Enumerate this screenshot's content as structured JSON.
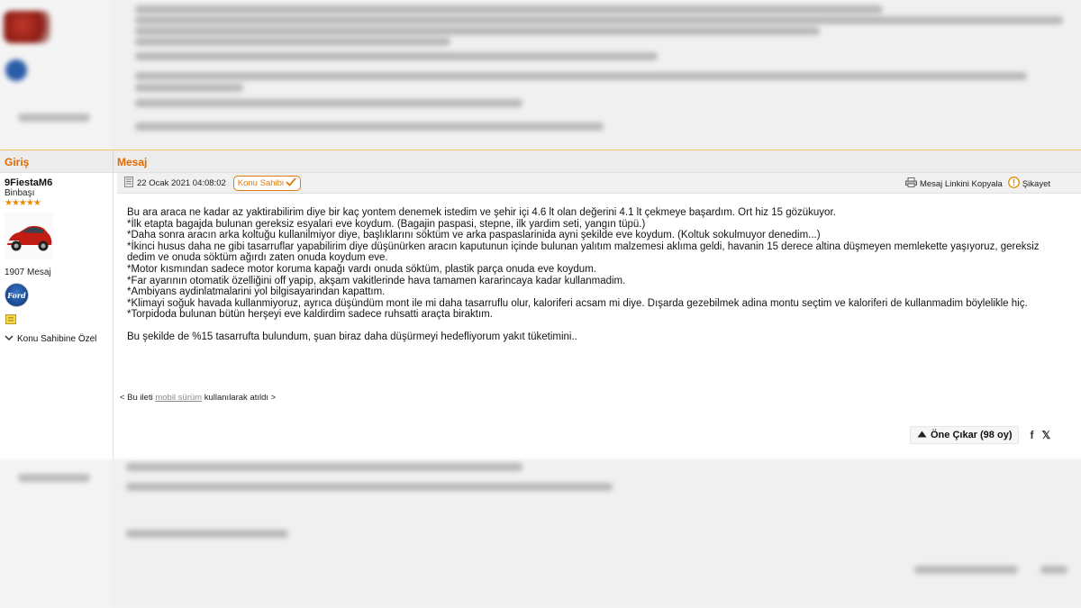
{
  "header": {
    "col_left": "Giriş",
    "col_right": "Mesaj"
  },
  "user": {
    "name": "9FiestaM6",
    "rank": "Binbaşı",
    "stars": "★★★★★",
    "post_count": "1907 Mesaj",
    "brand_logo_text": "Ford",
    "private_message": "Konu Sahibine Özel"
  },
  "post": {
    "timestamp": "22 Ocak 2021 04:08:02",
    "owner_badge": "Konu Sahibi",
    "copy_link": "Mesaj Linkini Kopyala",
    "report": "Şikayet",
    "lines": [
      "Bu ara araca ne kadar az yaktirabilirim diye bir kaç yontem denemek istedim ve şehir içi 4.6 lt olan değerini 4.1 lt çekmeye başardım. Ort hiz 15 gözükuyor.",
      "*İlk etapta bagajda bulunan gereksiz esyalari eve koydum. (Bagajin paspasi, stepne, ilk yardim seti, yangın tüpü.)",
      "*Daha sonra aracın arka koltuğu kullanilmiyor diye, başlıklarını söktüm ve arka paspaslarinida ayni şekilde eve koydum. (Koltuk sokulmuyor denedim...)",
      "*İkinci husus daha ne gibi tasarruflar yapabilirim diye düşünürken aracın kaputunun içinde bulunan yalıtım malzemesi aklıma geldi, havanin 15 derece altina düşmeyen memlekette yaşıyoruz, gereksiz dedim ve onuda söktüm ağırdı zaten onuda koydum eve.",
      "*Motor kısmından sadece motor koruma kapağı vardı onuda söktüm, plastik parça onuda eve koydum.",
      "*Far ayarının otomatik özelliğini off yapip, akşam vakitlerinde hava tamamen kararincaya kadar kullanmadim.",
      "*Ambiyans aydinlatmalarini yol bilgisayarindan kapattım.",
      "*Klimayi soğuk havada kullanmiyoruz, ayrıca düşündüm mont ile mi daha tasarruflu olur, kaloriferi acsam mi diye. Dışarda gezebilmek adina montu seçtim ve kaloriferi de kullanmadim böylelikle hiç.",
      "*Torpidoda bulunan bütün herşeyi eve kaldirdim sadece ruhsatti araçta biraktım."
    ],
    "closing": "Bu şekilde de %15 tasarrufta bulundum, şuan biraz daha düşürmeyi hedefliyorum yakıt tüketimini..",
    "mobile_prefix": "< Bu ileti",
    "mobile_link": "mobil sürüm",
    "mobile_suffix": "kullanılarak atıldı >",
    "upvote_label": "Öne Çıkar (98 oy)",
    "facebook": "f",
    "twitter": "𝕏"
  },
  "colors": {
    "accent": "#e06a00",
    "star": "#e58a00",
    "border": "#f2c46a"
  }
}
